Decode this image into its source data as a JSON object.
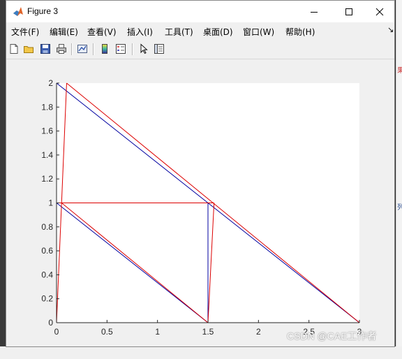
{
  "window": {
    "title": "Figure 3"
  },
  "menu": {
    "items": [
      "文件(F)",
      "编辑(E)",
      "查看(V)",
      "插入(I)",
      "工具(T)",
      "桌面(D)",
      "窗口(W)",
      "帮助(H)"
    ]
  },
  "toolbar": {
    "icons": [
      "new-figure-icon",
      "open-file-icon",
      "save-icon",
      "print-icon",
      "link-plot-icon",
      "insert-colorbar-icon",
      "insert-legend-icon",
      "select-arrow-icon",
      "property-inspector-icon"
    ]
  },
  "watermark": "CSDN @CAE工作者",
  "background_peek": {
    "right_text": [
      "果",
      "列"
    ]
  },
  "colors": {
    "series_blue": "#0000a0",
    "series_red": "#dd0000",
    "axes_bg": "#ffffff",
    "figure_bg": "#f0f0f0"
  },
  "chart_data": {
    "type": "line",
    "title": "",
    "xlabel": "",
    "ylabel": "",
    "xlim": [
      0,
      3
    ],
    "ylim": [
      0,
      2
    ],
    "xticks": [
      0,
      0.5,
      1,
      1.5,
      2,
      2.5,
      3
    ],
    "yticks": [
      0,
      0.2,
      0.4,
      0.6,
      0.8,
      1,
      1.2,
      1.4,
      1.6,
      1.8,
      2
    ],
    "xtick_labels": [
      "0",
      "0.5",
      "1",
      "1.5",
      "2",
      "2.5",
      "3"
    ],
    "ytick_labels": [
      "0",
      "0.2",
      "0.4",
      "0.6",
      "0.8",
      "1",
      "1.2",
      "1.4",
      "1.6",
      "1.8",
      "2"
    ],
    "grid": false,
    "series": [
      {
        "color": "#0000a0",
        "segments": [
          [
            [
              0,
              0
            ],
            [
              3,
              0
            ]
          ],
          [
            [
              3,
              0
            ],
            [
              0,
              2
            ]
          ],
          [
            [
              0,
              2
            ],
            [
              0,
              0
            ]
          ],
          [
            [
              0,
              1
            ],
            [
              1.5,
              0
            ]
          ],
          [
            [
              1.5,
              0
            ],
            [
              1.5,
              1
            ]
          ],
          [
            [
              1.5,
              1
            ],
            [
              0,
              1
            ]
          ]
        ]
      },
      {
        "color": "#dd0000",
        "segments": [
          [
            [
              0,
              0
            ],
            [
              3,
              0
            ]
          ],
          [
            [
              3,
              0
            ],
            [
              0.1,
              2
            ]
          ],
          [
            [
              0.1,
              2
            ],
            [
              0,
              0
            ]
          ],
          [
            [
              0.05,
              1
            ],
            [
              1.5,
              0
            ]
          ],
          [
            [
              1.5,
              0
            ],
            [
              1.56,
              1
            ]
          ],
          [
            [
              1.56,
              1
            ],
            [
              0,
              1
            ]
          ]
        ]
      }
    ]
  }
}
